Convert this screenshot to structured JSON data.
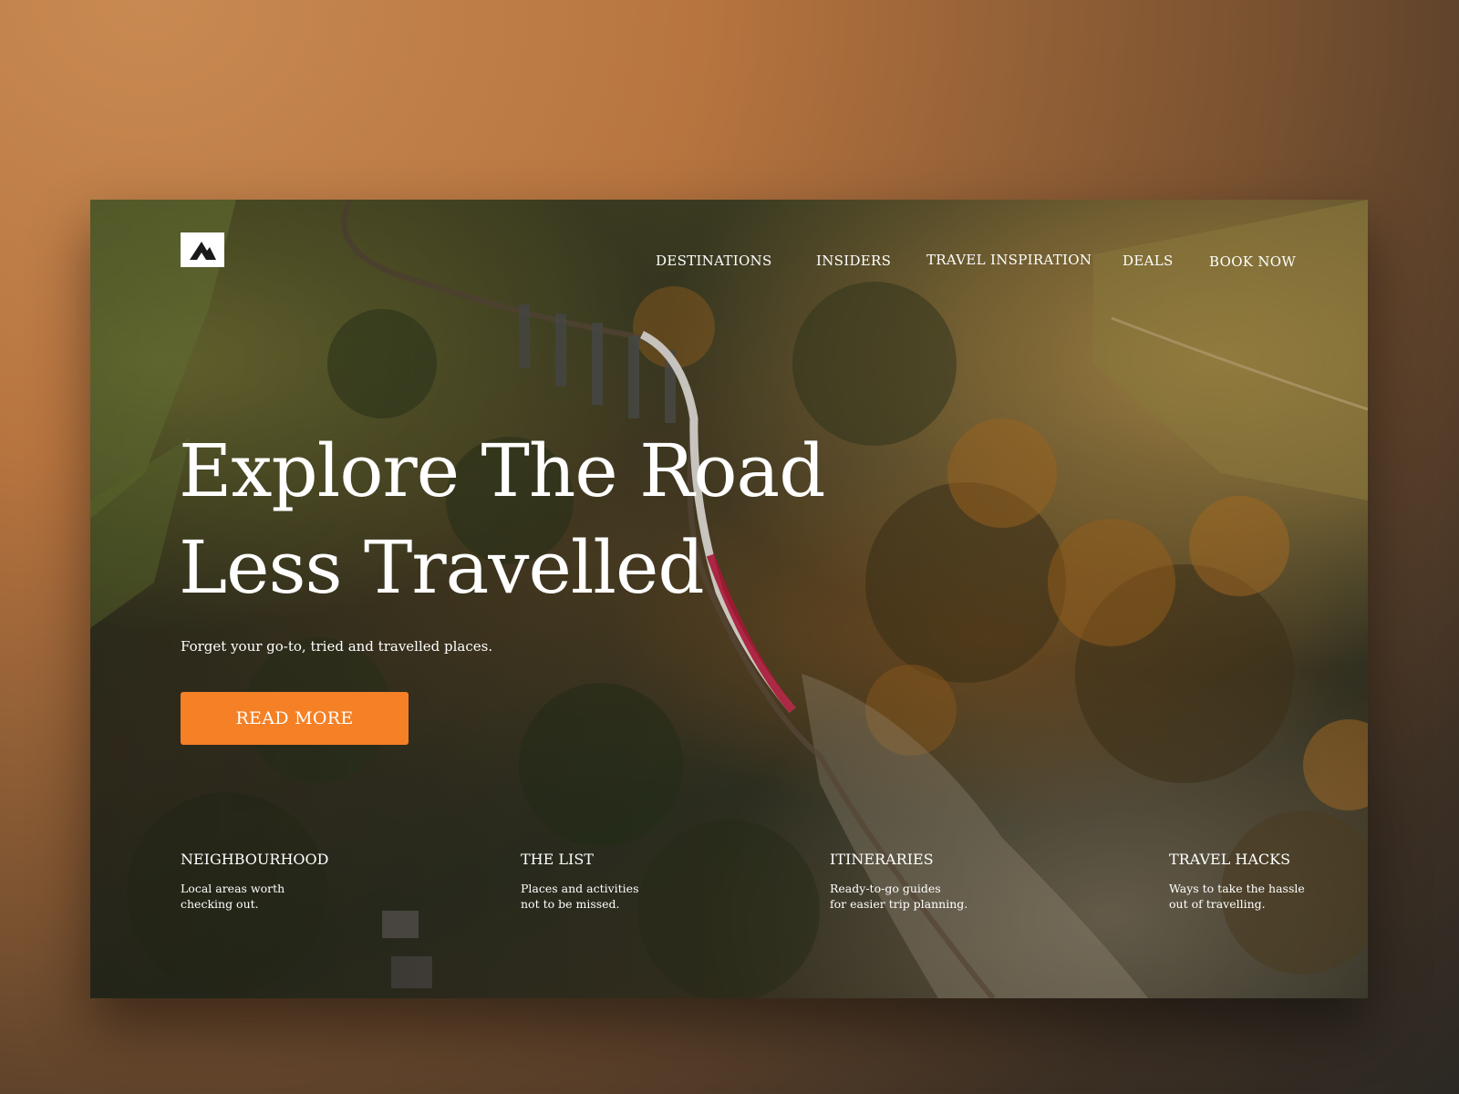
{
  "nav": {
    "items": [
      {
        "label": "DESTINATIONS"
      },
      {
        "label": "INSIDERS"
      },
      {
        "label": "TRAVEL INSPIRATION"
      },
      {
        "label": "DEALS"
      },
      {
        "label": "BOOK NOW"
      }
    ]
  },
  "logo": {
    "icon": "mountain-logo-icon"
  },
  "hero": {
    "headline_line1": "Explore The Road",
    "headline_line2": "Less Travelled",
    "subtitle": "Forget your go-to, tried and travelled places.",
    "cta_label": "READ MORE"
  },
  "features": [
    {
      "title": "NEIGHBOURHOOD",
      "description": "Local areas worth\nchecking out."
    },
    {
      "title": "THE LIST",
      "description": "Places and activities\nnot to be missed."
    },
    {
      "title": "ITINERARIES",
      "description": "Ready-to-go guides\nfor easier trip planning."
    },
    {
      "title": "TRAVEL HACKS",
      "description": "Ways to take the hassle\nout of travelling."
    }
  ],
  "colors": {
    "accent": "#f58025",
    "text": "#ffffff"
  }
}
